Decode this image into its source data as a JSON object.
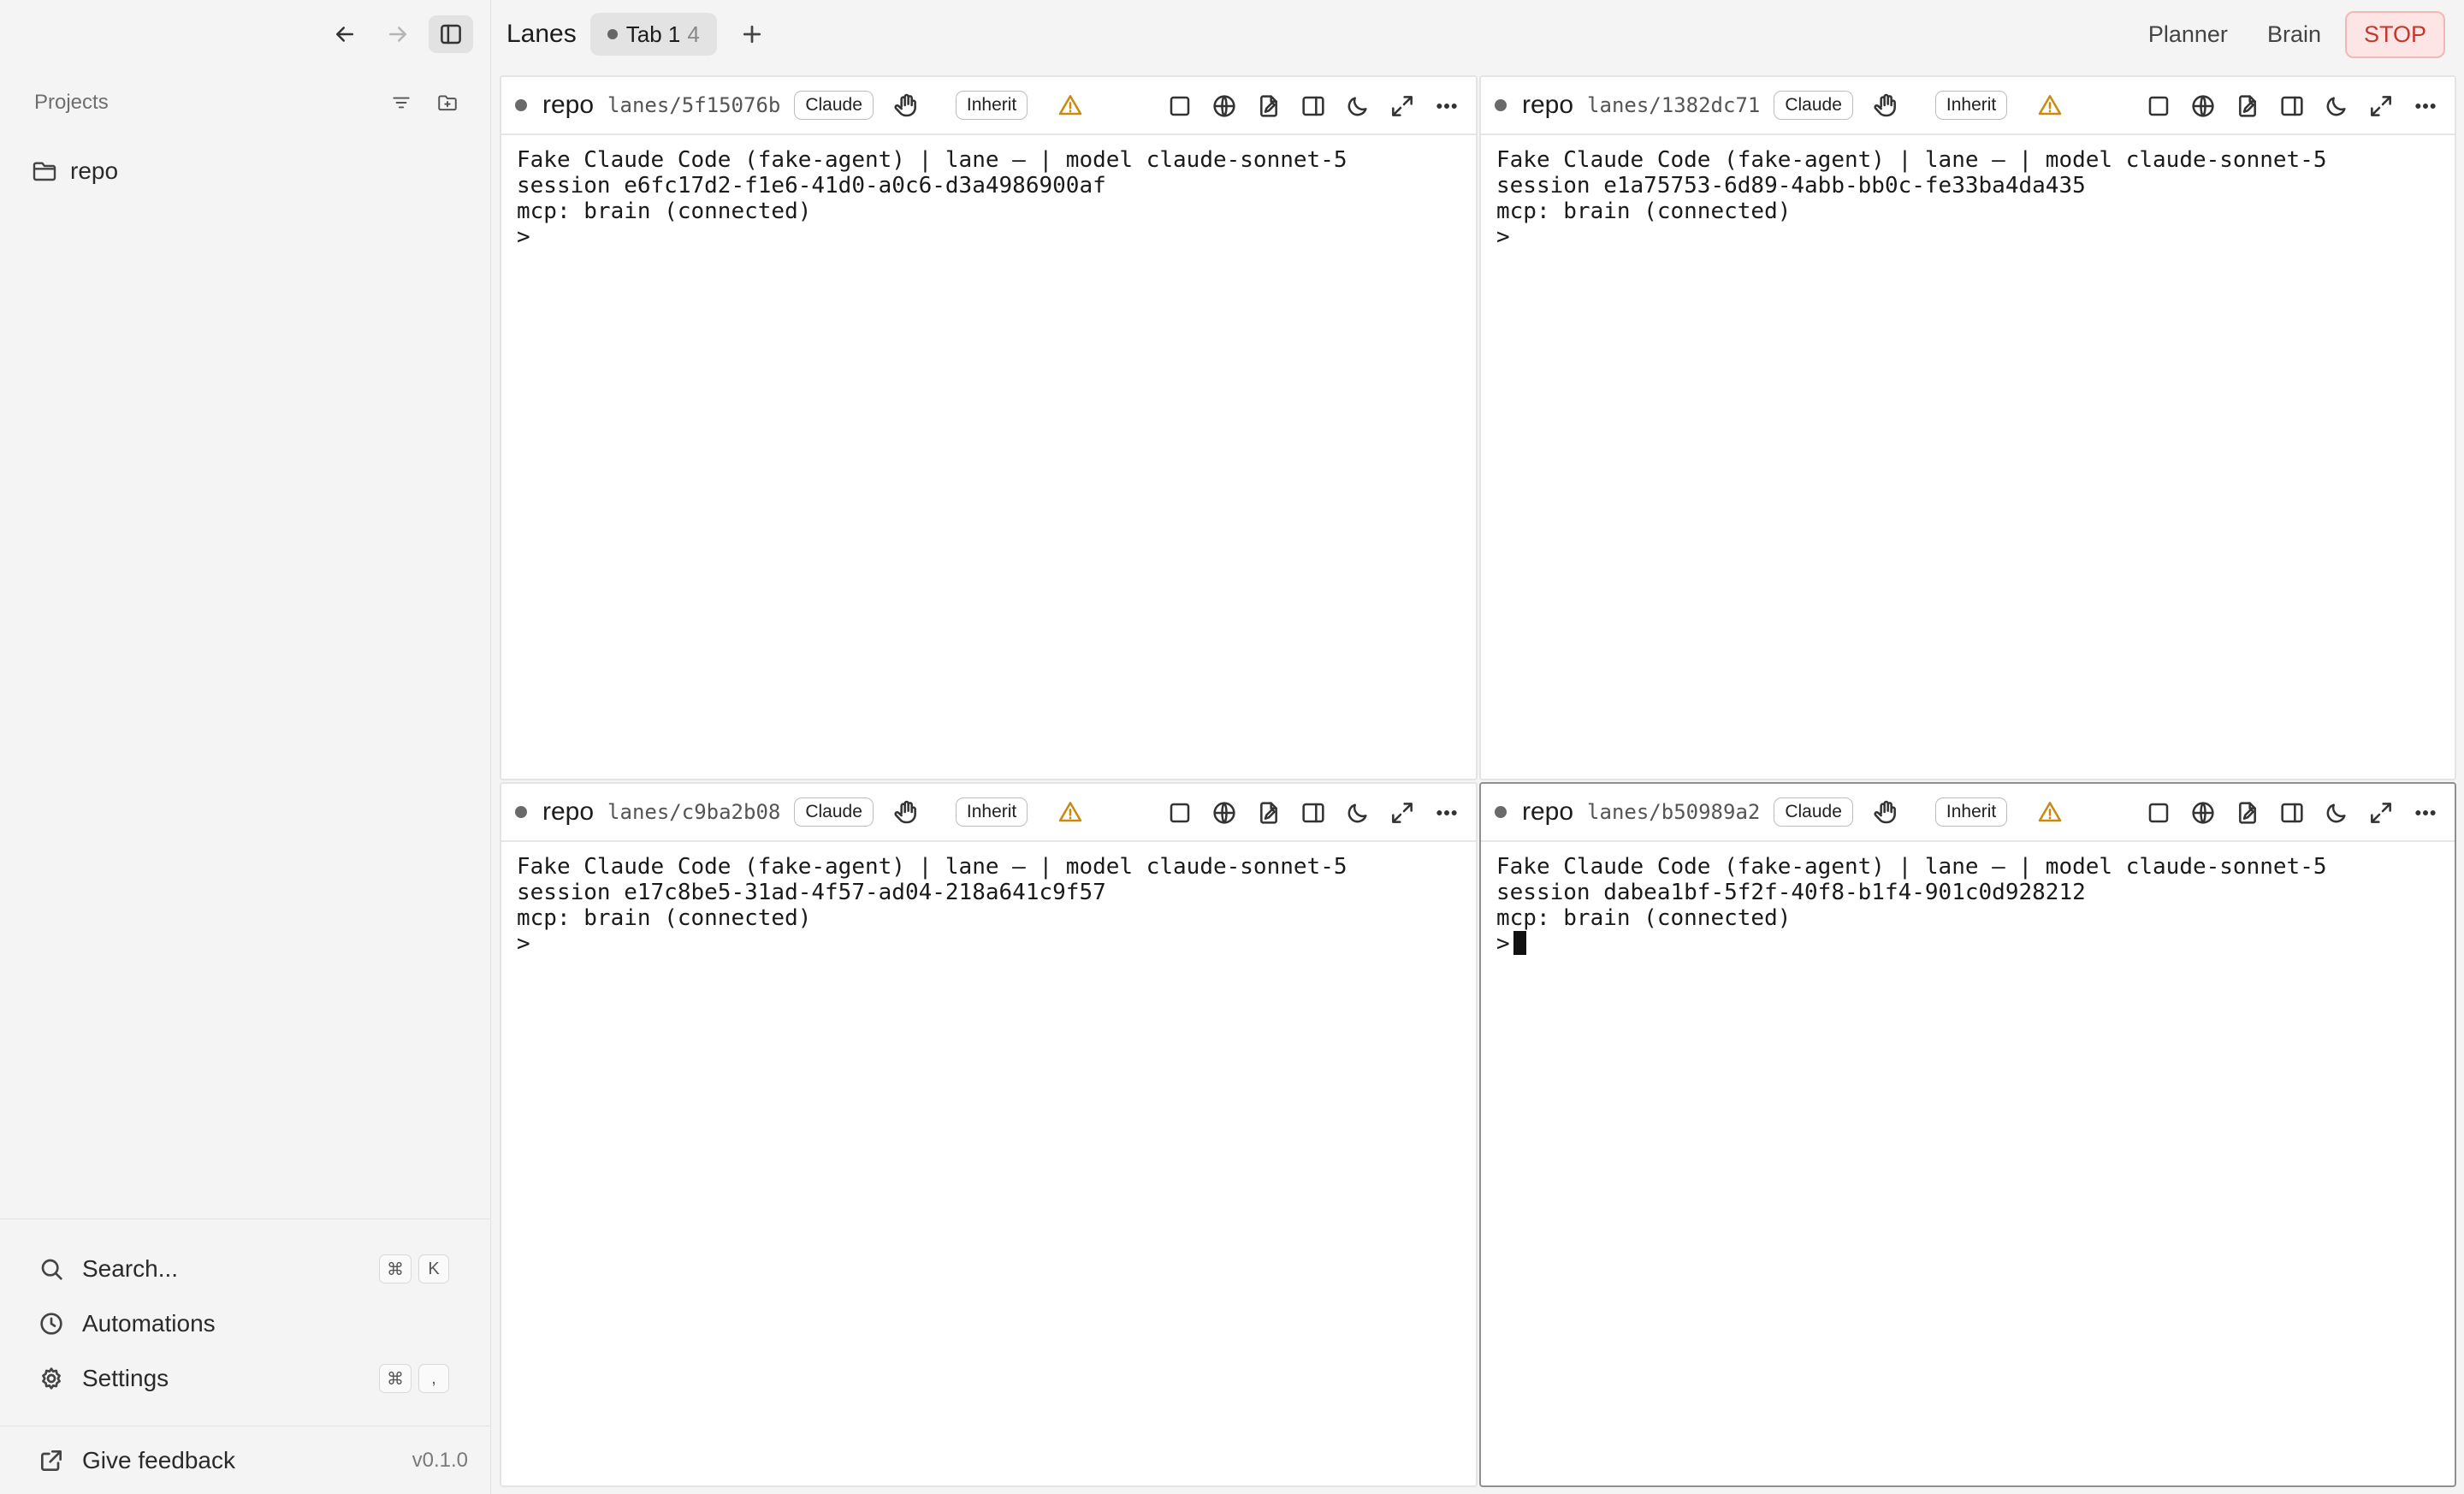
{
  "sidebar": {
    "projects_title": "Projects",
    "projects": [
      {
        "name": "repo"
      }
    ],
    "menu": {
      "search_label": "Search...",
      "search_shortcut": [
        "⌘",
        "K"
      ],
      "automations_label": "Automations",
      "settings_label": "Settings",
      "settings_shortcut": [
        "⌘",
        ","
      ]
    },
    "feedback_label": "Give feedback",
    "version": "v0.1.0"
  },
  "topbar": {
    "app_title": "Lanes",
    "tabs": [
      {
        "label": "Tab 1",
        "count": "4"
      }
    ],
    "planner_label": "Planner",
    "brain_label": "Brain",
    "stop_label": "STOP"
  },
  "panes": [
    {
      "repo": "repo",
      "branch": "lanes/5f15076b",
      "agent": "Claude",
      "mode": "Inherit",
      "lines": [
        "Fake Claude Code (fake-agent) | lane – | model claude-sonnet-5",
        "session e6fc17d2-f1e6-41d0-a0c6-d3a4986900af",
        "mcp: brain (connected)"
      ],
      "prompt": ">"
    },
    {
      "repo": "repo",
      "branch": "lanes/1382dc71",
      "agent": "Claude",
      "mode": "Inherit",
      "lines": [
        "Fake Claude Code (fake-agent) | lane – | model claude-sonnet-5",
        "session e1a75753-6d89-4abb-bb0c-fe33ba4da435",
        "mcp: brain (connected)"
      ],
      "prompt": ">"
    },
    {
      "repo": "repo",
      "branch": "lanes/c9ba2b08",
      "agent": "Claude",
      "mode": "Inherit",
      "lines": [
        "Fake Claude Code (fake-agent) | lane – | model claude-sonnet-5",
        "session e17c8be5-31ad-4f57-ad04-218a641c9f57",
        "mcp: brain (connected)"
      ],
      "prompt": ">"
    },
    {
      "repo": "repo",
      "branch": "lanes/b50989a2",
      "agent": "Claude",
      "mode": "Inherit",
      "lines": [
        "Fake Claude Code (fake-agent) | lane – | model claude-sonnet-5",
        "session dabea1bf-5f2f-40f8-b1f4-901c0d928212",
        "mcp: brain (connected)"
      ],
      "prompt": ">"
    }
  ],
  "icons": {
    "nav": [
      "back-arrow-icon",
      "forward-arrow-icon",
      "sidebar-toggle-icon"
    ],
    "pane_tools": [
      "square-icon",
      "globe-icon",
      "file-edit-icon",
      "split-panel-icon",
      "moon-icon",
      "expand-icon",
      "more-icon"
    ]
  },
  "colors": {
    "stop_text": "#c0392b",
    "stop_bg": "#fde5e5",
    "warning": "#c98a10"
  }
}
